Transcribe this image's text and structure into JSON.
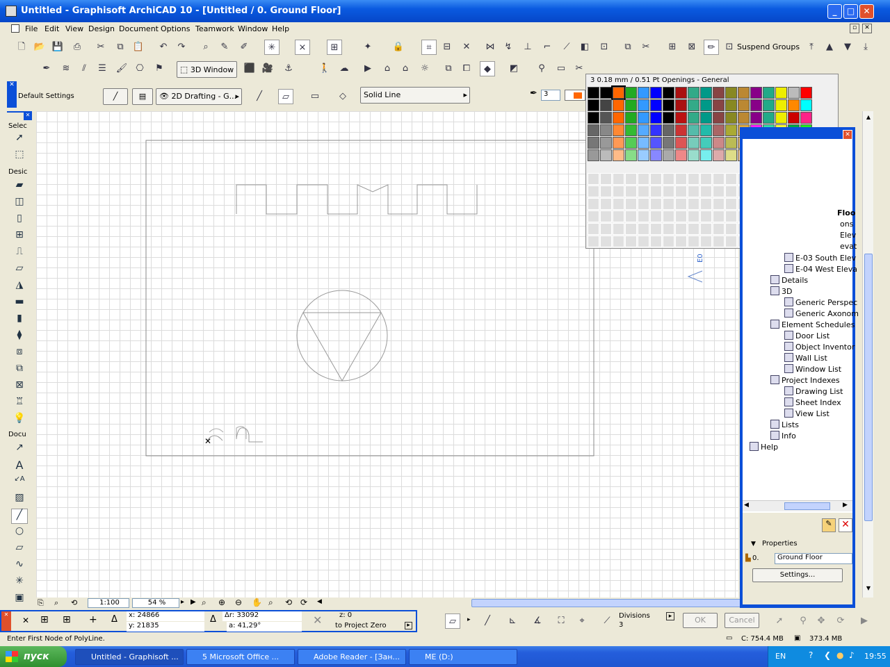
{
  "window": {
    "title": "Untitled - Graphisoft ArchiCAD 10 - [Untitled / 0. Ground Floor]"
  },
  "menu": [
    "File",
    "Edit",
    "View",
    "Design",
    "Document",
    "Options",
    "Teamwork",
    "Window",
    "Help"
  ],
  "toolbar": {
    "window3d": "3D Window",
    "suspend_groups": "Suspend Groups"
  },
  "infobox": {
    "default_settings": "Default Settings",
    "layer": "2D Drafting - G...",
    "line_type": "Solid Line",
    "pen_number": "3"
  },
  "palette": {
    "header": "3  0.18 mm /  0.51 Pt Openings - General",
    "colors": [
      [
        "#000000",
        "#000000",
        "#ff6600",
        "#22aa22",
        "#3399ff",
        "#0000ff",
        "#000000",
        "#aa1111",
        "#33aa88",
        "#009988",
        "#884444",
        "#888822",
        "#bb8833",
        "#880088",
        "#22aa88",
        "#eeee00",
        "#bbbbbb",
        "#ff0000"
      ],
      [
        "#000000",
        "#444444",
        "#ff6600",
        "#22aa22",
        "#3399ff",
        "#0000ff",
        "#000000",
        "#aa1111",
        "#33aa88",
        "#009988",
        "#884444",
        "#888822",
        "#bb8833",
        "#880088",
        "#22aa88",
        "#eeee00",
        "#ff8800",
        "#00ffff"
      ],
      [
        "#000000",
        "#555555",
        "#ff6600",
        "#22aa22",
        "#3399ff",
        "#0000ff",
        "#000000",
        "#bb1111",
        "#33aa88",
        "#009988",
        "#884444",
        "#888822",
        "#bb8833",
        "#880088",
        "#22aa88",
        "#eeee00",
        "#cc0000",
        "#ff2288"
      ],
      [
        "#666666",
        "#888888",
        "#ff8833",
        "#33bb33",
        "#55aaff",
        "#3333ff",
        "#666666",
        "#cc3333",
        "#55bbaa",
        "#22bbaa",
        "#aa6666",
        "#aaaa33",
        "#ddaa44",
        "#ff22ff",
        "#33ddaa",
        "#ffff33",
        "#00aa44",
        "#22ee22"
      ],
      [
        "#777777",
        "#999999",
        "#ff9955",
        "#55cc55",
        "#77bbff",
        "#5555ff",
        "#777777",
        "#dd5555",
        "#77ccbb",
        "#44ccbb",
        "#cc8888",
        "#bbbb55",
        "#eebb66",
        "#ff55ff",
        "#66eebb",
        "#ffff66",
        "#114488",
        "#ffff00"
      ],
      [
        "#999999",
        "#bbbbbb",
        "#ffbb88",
        "#88dd88",
        "#99ccff",
        "#8888ff",
        "#aaaaaa",
        "#ee8888",
        "#99ddcc",
        "#77eeee",
        "#ddaaaa",
        "#dddd88",
        "#ffcc88",
        "#ff99ff",
        "#99ffdd",
        "#ffff99",
        "#663333",
        "#000000"
      ]
    ]
  },
  "navigator": {
    "items": [
      {
        "label": "Floo",
        "indent": 0
      },
      {
        "label": "ons",
        "indent": 0
      },
      {
        "label": "Elev",
        "indent": 0
      },
      {
        "label": "evat",
        "indent": 0
      },
      {
        "label": "E-03 South Elev",
        "indent": 2
      },
      {
        "label": "E-04 West Eleva",
        "indent": 2
      },
      {
        "label": "Details",
        "indent": 1
      },
      {
        "label": "3D",
        "indent": 1
      },
      {
        "label": "Generic Perspec",
        "indent": 2
      },
      {
        "label": "Generic Axonom",
        "indent": 2
      },
      {
        "label": "Element Schedules",
        "indent": 1
      },
      {
        "label": "Door List",
        "indent": 2
      },
      {
        "label": "Object Inventor",
        "indent": 2
      },
      {
        "label": "Wall List",
        "indent": 2
      },
      {
        "label": "Window List",
        "indent": 2
      },
      {
        "label": "Project Indexes",
        "indent": 1
      },
      {
        "label": "Drawing List",
        "indent": 2
      },
      {
        "label": "Sheet Index",
        "indent": 2
      },
      {
        "label": "View List",
        "indent": 2
      },
      {
        "label": "Lists",
        "indent": 1
      },
      {
        "label": "Info",
        "indent": 1
      },
      {
        "label": "Help",
        "indent": 0
      }
    ],
    "properties": "Properties",
    "floor_num": "0.",
    "floor_name": "Ground Floor",
    "settings_btn": "Settings..."
  },
  "toolbox": {
    "select": "Selec",
    "design": "Desic",
    "document": "Docu"
  },
  "viewbar": {
    "scale": "1:100",
    "zoom": "54 %"
  },
  "coords": {
    "x": "x: 24866",
    "y": "y: 21835",
    "dr": "Δr: 33092",
    "a": "a: 41,29°",
    "z": "z: 0",
    "ref": "to Project Zero",
    "divisions_label": "Divisions",
    "divisions": "3",
    "ok": "OK",
    "cancel": "Cancel"
  },
  "status": {
    "prompt": "Enter First Node of PolyLine.",
    "disk": "C: 754.4 MB",
    "mem": "373.4 MB"
  },
  "taskbar": {
    "start": "пуск",
    "tasks": [
      "Untitled - Graphisoft ...",
      "5 Microsoft Office ...",
      "Adobe Reader - [Зан...",
      "ME (D:)"
    ],
    "lang": "EN",
    "clock": "19:55"
  },
  "canvas_labels": {
    "side": "E0"
  }
}
